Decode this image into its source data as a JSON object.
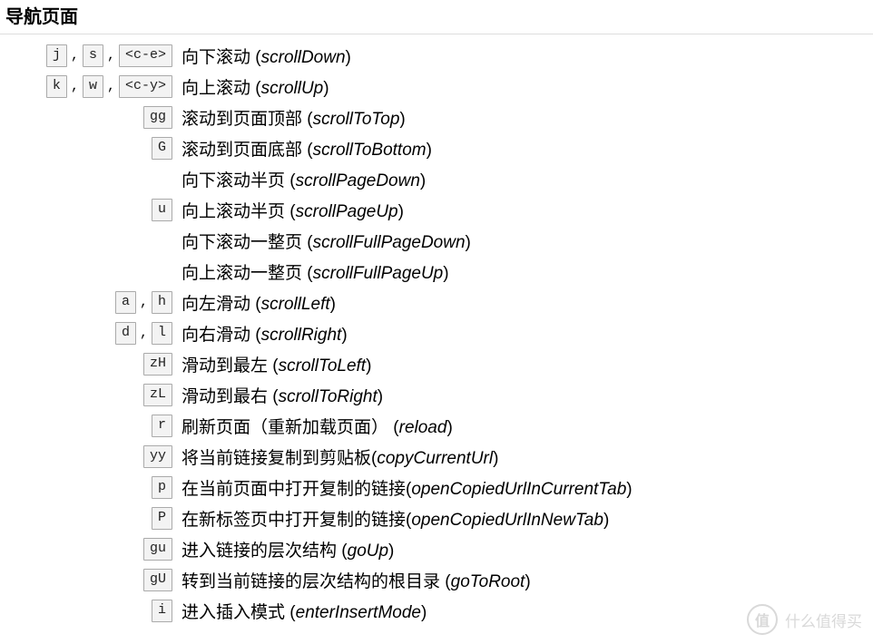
{
  "heading": "导航页面",
  "rows": [
    {
      "keys": [
        "j",
        "s",
        "<c-e>"
      ],
      "label": "向下滚动",
      "command": "scrollDown",
      "sep": " (",
      "close": ")"
    },
    {
      "keys": [
        "k",
        "w",
        "<c-y>"
      ],
      "label": "向上滚动",
      "command": "scrollUp",
      "sep": " (",
      "close": ")"
    },
    {
      "keys": [
        "gg"
      ],
      "label": "滚动到页面顶部",
      "command": "scrollToTop",
      "sep": " (",
      "close": ")"
    },
    {
      "keys": [
        "G"
      ],
      "label": "滚动到页面底部",
      "command": "scrollToBottom",
      "sep": " (",
      "close": ")"
    },
    {
      "keys": [],
      "label": "向下滚动半页",
      "command": "scrollPageDown",
      "sep": " (",
      "close": ")"
    },
    {
      "keys": [
        "u"
      ],
      "label": "向上滚动半页",
      "command": "scrollPageUp",
      "sep": " (",
      "close": ")"
    },
    {
      "keys": [],
      "label": "向下滚动一整页",
      "command": "scrollFullPageDown",
      "sep": " (",
      "close": ")"
    },
    {
      "keys": [],
      "label": "向上滚动一整页",
      "command": "scrollFullPageUp",
      "sep": " (",
      "close": ")"
    },
    {
      "keys": [
        "a",
        "h"
      ],
      "label": "向左滑动",
      "command": "scrollLeft",
      "sep": " (",
      "close": ")"
    },
    {
      "keys": [
        "d",
        "l"
      ],
      "label": "向右滑动",
      "command": "scrollRight",
      "sep": " (",
      "close": ")"
    },
    {
      "keys": [
        "zH"
      ],
      "label": "滑动到最左",
      "command": "scrollToLeft",
      "sep": " (",
      "close": ")"
    },
    {
      "keys": [
        "zL"
      ],
      "label": "滑动到最右",
      "command": "scrollToRight",
      "sep": " (",
      "close": ")"
    },
    {
      "keys": [
        "r"
      ],
      "label": "刷新页面（重新加载页面）",
      "command": "reload",
      "sep": " (",
      "close": ")"
    },
    {
      "keys": [
        "yy"
      ],
      "label": "将当前链接复制到剪贴板",
      "command": "copyCurrentUrl",
      "sep": "(",
      "close": ")"
    },
    {
      "keys": [
        "p"
      ],
      "label": "在当前页面中打开复制的链接",
      "command": "openCopiedUrlInCurrentTab",
      "sep": "(",
      "close": ")"
    },
    {
      "keys": [
        "P"
      ],
      "label": "在新标签页中打开复制的链接",
      "command": "openCopiedUrlInNewTab",
      "sep": "(",
      "close": ")"
    },
    {
      "keys": [
        "gu"
      ],
      "label": "进入链接的层次结构",
      "command": "goUp",
      "sep": " (",
      "close": ")"
    },
    {
      "keys": [
        "gU"
      ],
      "label": "转到当前链接的层次结构的根目录",
      "command": "goToRoot",
      "sep": " (",
      "close": ")"
    },
    {
      "keys": [
        "i"
      ],
      "label": "进入插入模式",
      "command": "enterInsertMode",
      "sep": " (",
      "close": ")"
    }
  ],
  "watermark": {
    "badge": "值",
    "text": "什么值得买"
  }
}
